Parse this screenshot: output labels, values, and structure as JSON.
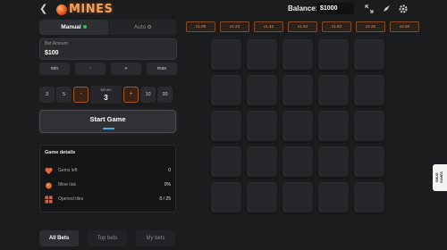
{
  "header": {
    "back_icon": "chevron-left-icon",
    "logo_text": "MINES",
    "balance_label": "Balance:",
    "balance_value": "$1000",
    "icons": [
      "expand-icon",
      "rocket-icon",
      "gear-icon"
    ]
  },
  "mode_tabs": {
    "manual": "Manual",
    "auto": "Auto"
  },
  "multipliers": [
    "x1.08",
    "x1.23",
    "x1.42",
    "x1.64",
    "x1.92",
    "x2.25",
    "x2.68"
  ],
  "bet": {
    "label": "Bet Amount",
    "value": "$100"
  },
  "amount_buttons": [
    "min",
    "-",
    "+",
    "max"
  ],
  "mines": {
    "presets_left": [
      "3",
      "5"
    ],
    "minus": "-",
    "label": "Mines",
    "value": "3",
    "plus": "+",
    "presets_right": [
      "10",
      "20"
    ]
  },
  "start_button": "Start Game",
  "game_details": {
    "title": "Game details",
    "rows": [
      {
        "icon": "heart-icon",
        "label": "Gems left",
        "value": "0"
      },
      {
        "icon": "fire-icon",
        "label": "Mine risk",
        "value": "0%"
      },
      {
        "icon": "grid-icon",
        "label": "Opened tiles",
        "value": "0 / 25"
      }
    ]
  },
  "bottom_tabs": [
    "All Bets",
    "Top bets",
    "My bets"
  ],
  "side_badge": "SMUG GAMES",
  "colors": {
    "accent": "#e0541a",
    "multiplier_border": "#8a4a25",
    "tile": "#26272a",
    "background": "#1b1c1e"
  }
}
